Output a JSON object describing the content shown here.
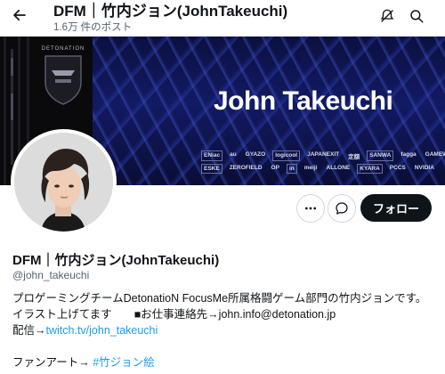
{
  "header": {
    "title": "DFM｜竹内ジョン(JohnTakeuchi)",
    "post_count": "1.6万 件のポスト"
  },
  "banner": {
    "name": "John Takeuchi",
    "crest_label": "DETONATION",
    "sponsors_row1": [
      "ENiac",
      "au",
      "GYAZO",
      "logicool",
      "JAPANEXIT",
      "定額",
      "SANWA",
      "fagga",
      "GAMEWITH"
    ],
    "sponsors_row2": [
      "ESKE",
      "ZEROFIELD",
      "OP",
      "in",
      "meiji",
      "ALLONE",
      "KYARA",
      "PCCS",
      "NVIDIA"
    ]
  },
  "profile": {
    "name": "DFM｜竹内ジョン(JohnTakeuchi)",
    "handle": "@john_takeuchi",
    "follow_label": "フォロー",
    "bio_line1": "プロゲーミングチームDetonatioN FocusMe所属格闘ゲーム部門の竹内ジョンです。",
    "bio_line2": "イラスト上げてます　　■お仕事連絡先→john.info@detonation.jp",
    "bio_line3_prefix": "配信→",
    "bio_line3_link": "twitch.tv/john_takeuchi",
    "bio_line4_prefix": "ファンアート→ ",
    "bio_line4_link": "#竹ジョン絵"
  },
  "icons": {
    "back": "arrow-left-icon",
    "notify": "bell-off-icon",
    "search": "search-icon",
    "more": "more-icon",
    "message": "message-icon"
  }
}
